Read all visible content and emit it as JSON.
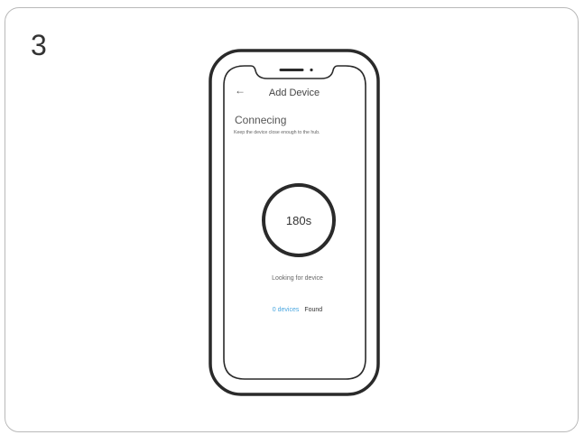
{
  "step": {
    "number": "3"
  },
  "screen": {
    "header": {
      "back_icon": "arrow-left-icon",
      "back_glyph": "←",
      "title": "Add Device"
    },
    "status_title": "Connecing",
    "subtitle": "Keep the device close enough to the hub.",
    "timer": {
      "label": "180s"
    },
    "looking_text": "Looking for device",
    "devices_count": "0 devices",
    "found_label": "Found"
  },
  "colors": {
    "border": "#b9b9b9",
    "phone_outline": "#2a2a2a",
    "accent_blue": "#4aa7e0",
    "text": "#333333"
  }
}
